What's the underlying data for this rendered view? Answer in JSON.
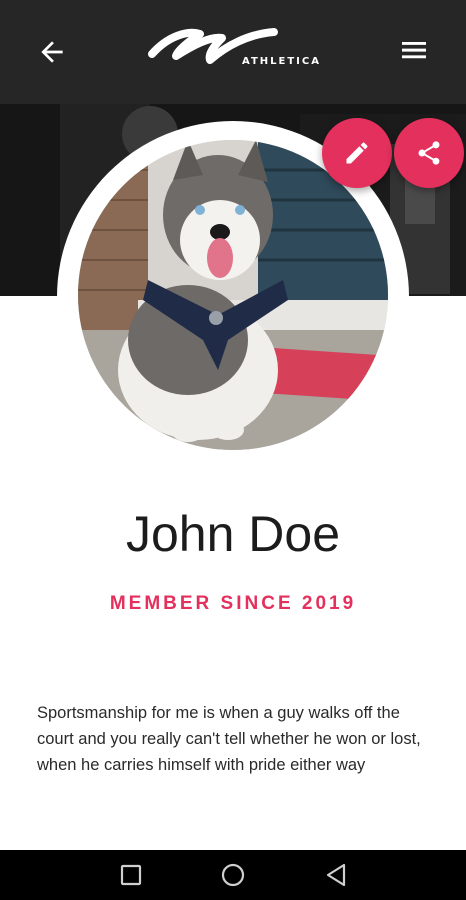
{
  "appbar": {
    "logo_text": "ATHLETICA",
    "back_icon": "arrow-left-icon",
    "menu_icon": "hamburger-menu-icon"
  },
  "profile": {
    "name": "John Doe",
    "member_since": "MEMBER SINCE 2019",
    "bio": "Sportsmanship for me is when a guy walks off the court and you really can't tell whether he won or lost, when he carries himself with pride either way",
    "avatar_subject": "husky dog sitting on pavement"
  },
  "actions": {
    "edit_icon": "pencil-icon",
    "share_icon": "share-icon"
  },
  "navbar": {
    "icons": [
      "square-recents-icon",
      "circle-home-icon",
      "triangle-back-icon"
    ]
  },
  "colors": {
    "accent": "#e3305c",
    "appbar": "#262626",
    "text": "#1c1c1c"
  }
}
